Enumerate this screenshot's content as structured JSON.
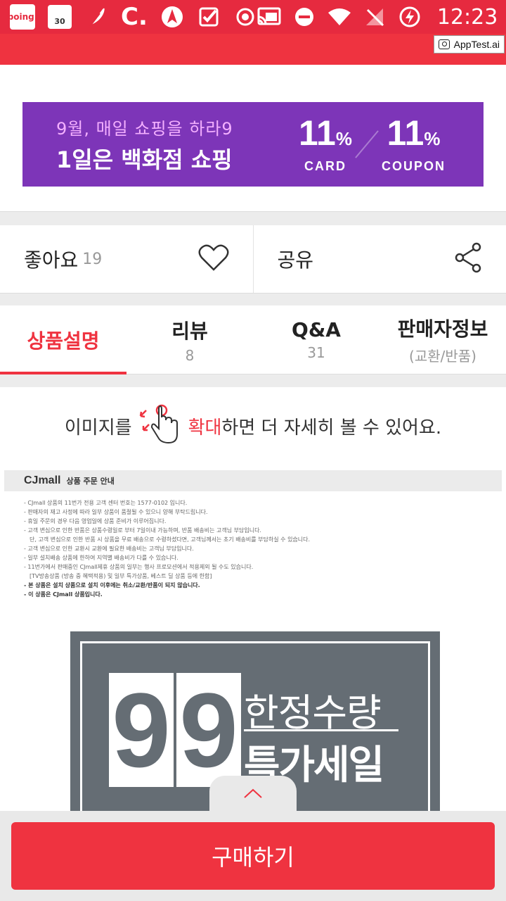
{
  "status_bar": {
    "poing_label": "poing.",
    "calendar_day": "30",
    "c_label": "C.",
    "time": "12:23"
  },
  "overlay": {
    "apptest_label": "AppTest.ai"
  },
  "banner": {
    "subtitle": "9월, 매일 쇼핑을 하라9",
    "title": "1일은 백화점 쇼핑",
    "card_pct": "11",
    "card_label": "CARD",
    "coupon_pct": "11",
    "coupon_label": "COUPON",
    "pct_sign": "%"
  },
  "actions": {
    "like_label": "좋아요",
    "like_count": "19",
    "share_label": "공유"
  },
  "tabs": [
    {
      "label": "상품설명",
      "sub": "",
      "active": true
    },
    {
      "label": "리뷰",
      "sub": "8",
      "active": false
    },
    {
      "label": "Q&A",
      "sub": "31",
      "active": false
    },
    {
      "label": "판매자정보",
      "sub": "(교환/반품)",
      "active": false
    }
  ],
  "zoom_hint": {
    "before": "이미지를",
    "highlight": "확대",
    "after": "하면 더 자세히 볼 수 있어요."
  },
  "notice": {
    "brand": "CJmall",
    "title": "상품 주문 안내",
    "lines": [
      {
        "text": "- CJmall 상품의 11번가 전용 고객 센터 번호는 1577-0102 입니다.",
        "bold": false
      },
      {
        "text": "- 판매자의 재고 사정에 따라 일부 상품이 품절될 수 있으니 양해 부탁드립니다.",
        "bold": false
      },
      {
        "text": "- 휴일 주문의 경우 다음 영업일에 상품 준비가 이루어집니다.",
        "bold": false
      },
      {
        "text": "- 고객 변심으로 인한 반품은 상품수령일로 부터 7일이내 가능하며, 반품 배송비는 고객님 부담입니다.",
        "bold": false
      },
      {
        "text": "  단, 고객 변심으로 인한 반품 시 상품을 무료 배송으로 수령하셨다면, 고객님께서는 초기 배송비를 부담하실 수 있습니다.",
        "bold": false
      },
      {
        "text": "- 고객 변심으로 인한 교환시 교환에 필요한 배송비는 고객님 부담입니다.",
        "bold": false
      },
      {
        "text": "- 일부 설치배송 상품에 한하여 지역별 배송비가 다를 수 있습니다.",
        "bold": false
      },
      {
        "text": "- 11번가에서 판매중인 CJmall제휴 상품의 일부는 행사 프로모션에서 적용제외 될 수도 있습니다.",
        "bold": false
      },
      {
        "text": "  [TV방송상품 (방송 중 혜택적용) 및 일부 특가상품, 베스트 딜 상품 등에 한함]",
        "bold": false
      },
      {
        "text": "- 본 상품은 설치 상품으로 설치 이후에는 취소/교환/반품이 되지 않습니다.",
        "bold": true
      },
      {
        "text": "- 이 상품은 CJmall 상품입니다.",
        "bold": true
      }
    ]
  },
  "poster": {
    "digit1": "9",
    "digit2": "9",
    "line1": "한정수량",
    "line2": "특가세일"
  },
  "buy_button": {
    "label": "구매하기"
  },
  "colors": {
    "accent": "#ef3340",
    "banner": "#7d35b8",
    "poster": "#656d74"
  }
}
